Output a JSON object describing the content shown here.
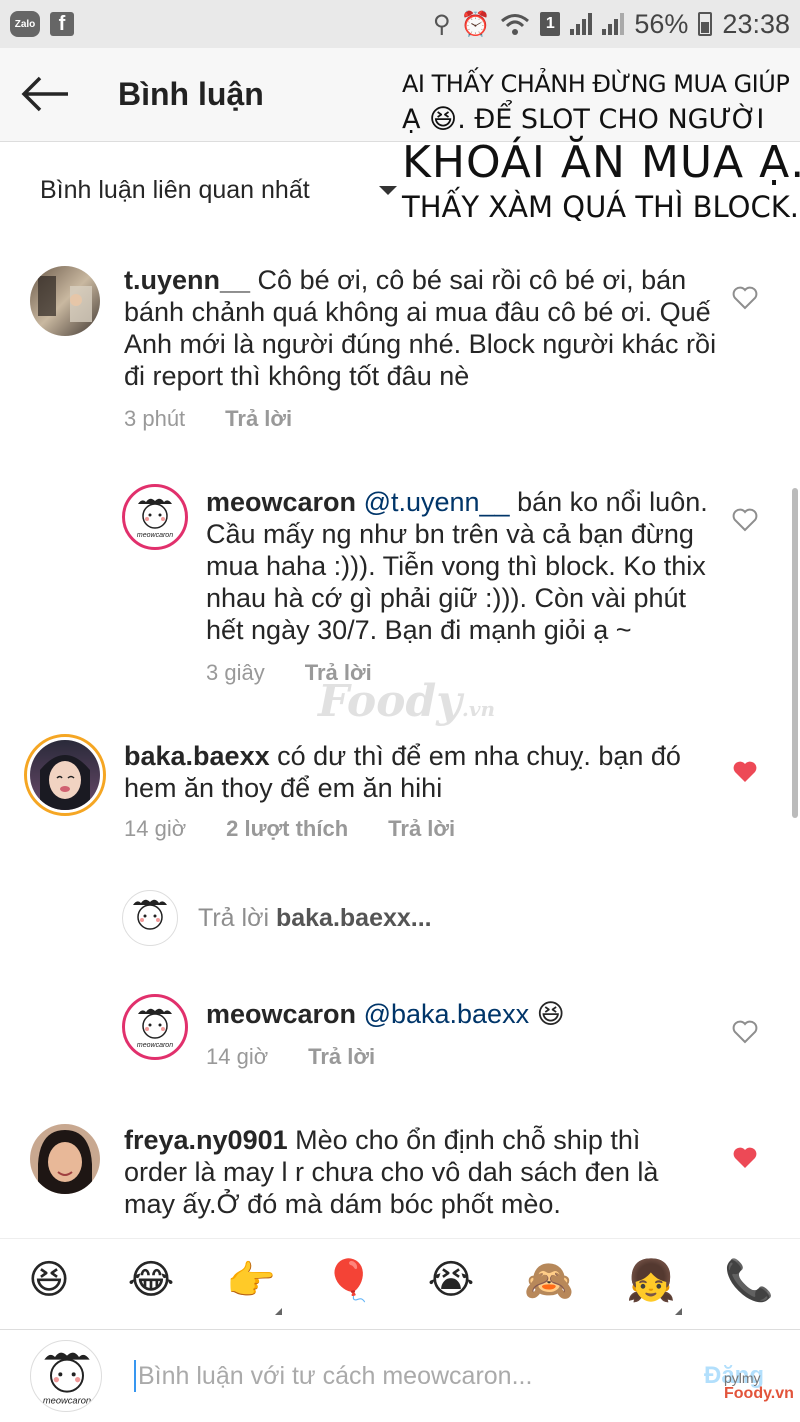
{
  "status_bar": {
    "zalo_label": "Zalo",
    "fb_label": "f",
    "sim_label": "1",
    "battery": "56%",
    "time": "23:38"
  },
  "header": {
    "title": "Bình luận"
  },
  "overlay_note": {
    "line1": "AI THẤY CHẢNH ĐỪNG MUA GIÚP",
    "line2": "Ạ 😆. ĐỂ SLOT CHO NGƯỜI",
    "line3": "KHOÁI ĂN MUA Ạ.",
    "line4": "THẤY XÀM QUÁ THÌ BLOCK."
  },
  "sort": {
    "label": "Bình luận liên quan nhất"
  },
  "comments": [
    {
      "username": "t.uyenn__",
      "text": " Cô bé ơi, cô bé sai rồi cô bé ơi, bán bánh chảnh quá không ai mua đâu cô bé ơi. Quế Anh mới là người đúng nhé. Block người khác rồi đi report thì không tốt đâu nè",
      "time": "3 phút",
      "reply": "Trả lời",
      "liked": false
    },
    {
      "username": "meowcaron",
      "mention": "@t.uyenn__",
      "text": " bán ko nổi luôn. Cầu mấy ng như bn trên và cả bạn đừng mua haha :))). Tiễn vong thì block. Ko thix nhau hà cớ gì phải giữ :))). Còn vài phút hết ngày 30/7. Bạn đi mạnh giỏi ạ ~",
      "time": "3 giây",
      "reply": "Trả lời",
      "liked": false
    },
    {
      "username": "baka.baexx",
      "text": " có dư thì để em nha chuỵ. bạn đó hem ăn thoy để em ăn hihi",
      "time": "14 giờ",
      "likes": "2 lượt thích",
      "reply": "Trả lời",
      "liked": true
    },
    {
      "username": "meowcaron",
      "mention": "@baka.baexx",
      "text": " 😆",
      "time": "14 giờ",
      "reply": "Trả lời",
      "liked": false
    },
    {
      "username": "freya.ny0901",
      "text": " Mèo cho ổn định chỗ ship thì order là may l r chưa cho vô dah sách đen là may ấy.Ở đó mà dám bóc phốt mèo.",
      "liked": true
    }
  ],
  "reply_prompt": {
    "prefix": "Trả lời ",
    "target": "baka.baexx..."
  },
  "emoji_bar": [
    "😆",
    "😂",
    "👉",
    "🎈",
    "😭",
    "🙈",
    "👧",
    "📞"
  ],
  "composer": {
    "placeholder": "Bình luận với tư cách meowcaron...",
    "post_label": "Đăng"
  },
  "watermarks": {
    "center": "Foody",
    "center_suffix": ".vn",
    "corner_top": "pylmy",
    "corner_bottom": "Foody.vn"
  },
  "colors": {
    "heart_liked": "#ed4956",
    "heart_empty": "#8e8e8e",
    "mention": "#003569",
    "ring": "#e1306c"
  }
}
